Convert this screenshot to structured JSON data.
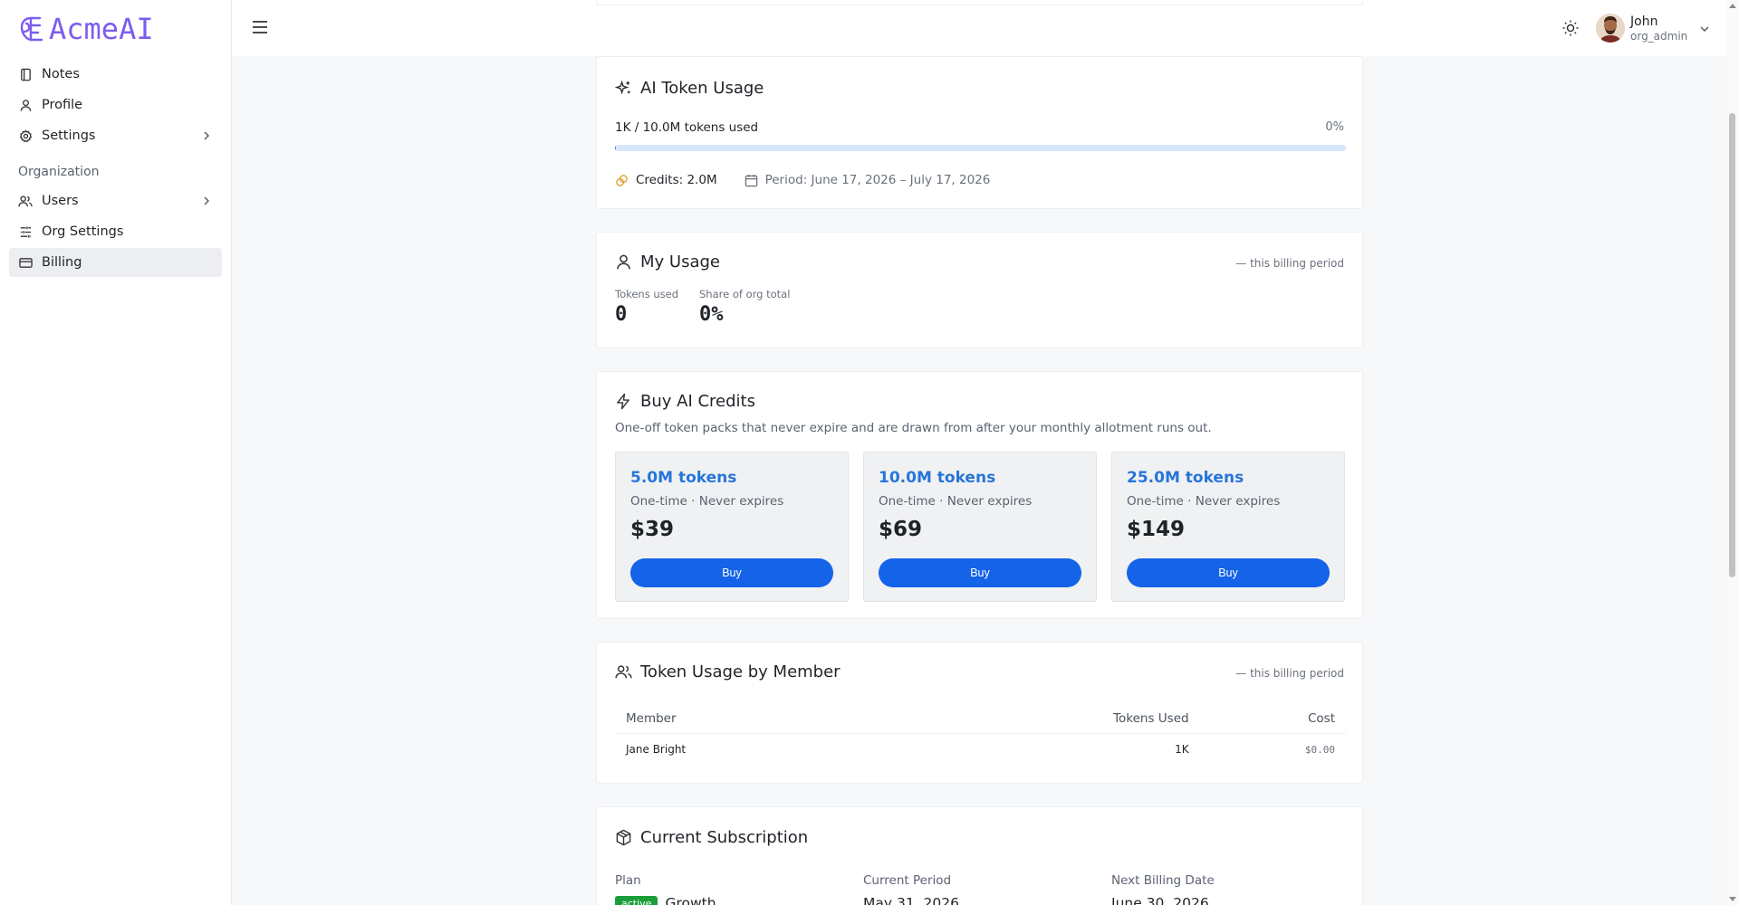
{
  "brand": {
    "name": "AcmeAI",
    "color": "#7c5cf0"
  },
  "sidebar": {
    "items": [
      {
        "label": "Notes",
        "icon": "notebook-icon"
      },
      {
        "label": "Profile",
        "icon": "user-icon"
      },
      {
        "label": "Settings",
        "icon": "gear-icon",
        "has_children": true
      }
    ],
    "section_label": "Organization",
    "org_items": [
      {
        "label": "Users",
        "icon": "users-icon",
        "has_children": true
      },
      {
        "label": "Org Settings",
        "icon": "sliders-icon"
      },
      {
        "label": "Billing",
        "icon": "credit-card-icon",
        "active": true
      }
    ]
  },
  "header": {
    "user_name": "John",
    "user_role": "org_admin"
  },
  "token_usage": {
    "title": "AI Token Usage",
    "used_text": "1K / 10.0M tokens used",
    "percent_text": "0%",
    "progress_fraction": 0.0001,
    "credits_text": "Credits: 2.0M",
    "period_text": "Period: June 17, 2026 – July 17, 2026"
  },
  "my_usage": {
    "title": "My Usage",
    "period_note": "— this billing period",
    "tokens_label": "Tokens used",
    "tokens_value": "0",
    "share_label": "Share of org total",
    "share_value": "0%"
  },
  "buy_credits": {
    "title": "Buy AI Credits",
    "description": "One-off token packs that never expire and are drawn from after your monthly allotment runs out.",
    "packs": [
      {
        "name": "5.0M tokens",
        "sub": "One-time · Never expires",
        "price": "$39",
        "button": "Buy"
      },
      {
        "name": "10.0M tokens",
        "sub": "One-time · Never expires",
        "price": "$69",
        "button": "Buy"
      },
      {
        "name": "25.0M tokens",
        "sub": "One-time · Never expires",
        "price": "$149",
        "button": "Buy"
      }
    ]
  },
  "member_usage": {
    "title": "Token Usage by Member",
    "period_note": "— this billing period",
    "columns": [
      "Member",
      "Tokens Used",
      "Cost"
    ],
    "rows": [
      {
        "member": "Jane Bright",
        "tokens": "1K",
        "cost": "$0.00"
      }
    ]
  },
  "subscription": {
    "title": "Current Subscription",
    "plan_label": "Plan",
    "plan_status": "active",
    "plan_name": "Growth",
    "period_label": "Current Period",
    "period_value": "May 31, 2026",
    "next_label": "Next Billing Date",
    "next_value": "June 30, 2026"
  },
  "colors": {
    "accent_blue": "#1463e8",
    "pack_title_blue": "#2675d9",
    "progress_track": "#d6e6fb",
    "active_badge": "#1a9e3a"
  }
}
